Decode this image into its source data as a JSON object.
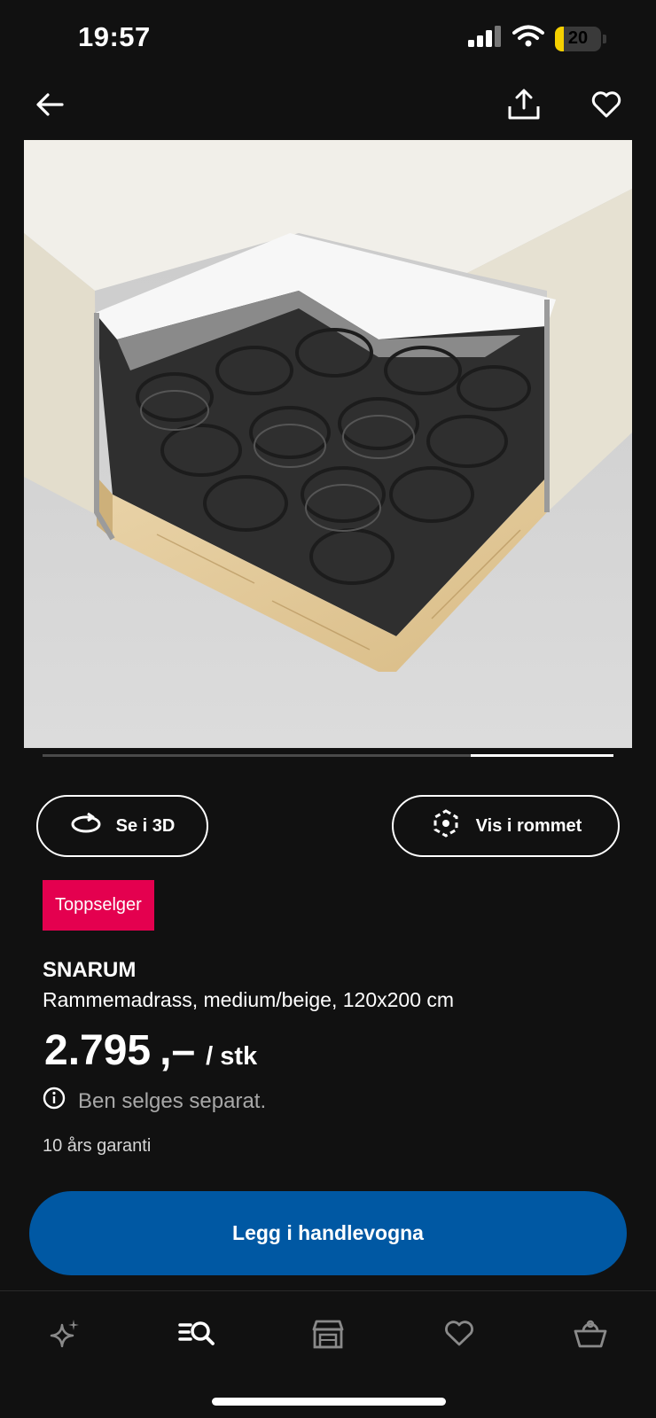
{
  "status_bar": {
    "time": "19:57",
    "battery_level": "20",
    "battery_fraction": 0.2,
    "icons": [
      "cellular-signal-icon",
      "wifi-icon",
      "battery-icon"
    ]
  },
  "top_nav": {
    "icons": [
      "back-arrow-icon",
      "share-icon",
      "heart-icon"
    ]
  },
  "gallery": {
    "progress_fraction": 0.25,
    "image": "mattress-cutaway"
  },
  "actions": {
    "view_3d_label": "Se i 3D",
    "view_in_room_label": "Vis i rommet"
  },
  "badge": {
    "label": "Toppselger",
    "color": "#e4004f"
  },
  "product": {
    "name": "SNARUM",
    "description": "Rammemadrass, medium/beige, 120x200 cm",
    "price": "2.795",
    "price_suffix": ",–",
    "unit": "/ stk",
    "info_text": "Ben selges separat.",
    "warranty": "10 års garanti"
  },
  "cart_button": {
    "label": "Legg i handlevogna",
    "color": "#0058a3"
  },
  "tab_bar": {
    "tabs": [
      "sparkle-icon",
      "search-list-icon",
      "store-icon",
      "heart-icon",
      "basket-icon"
    ],
    "active": "search-list-icon"
  }
}
